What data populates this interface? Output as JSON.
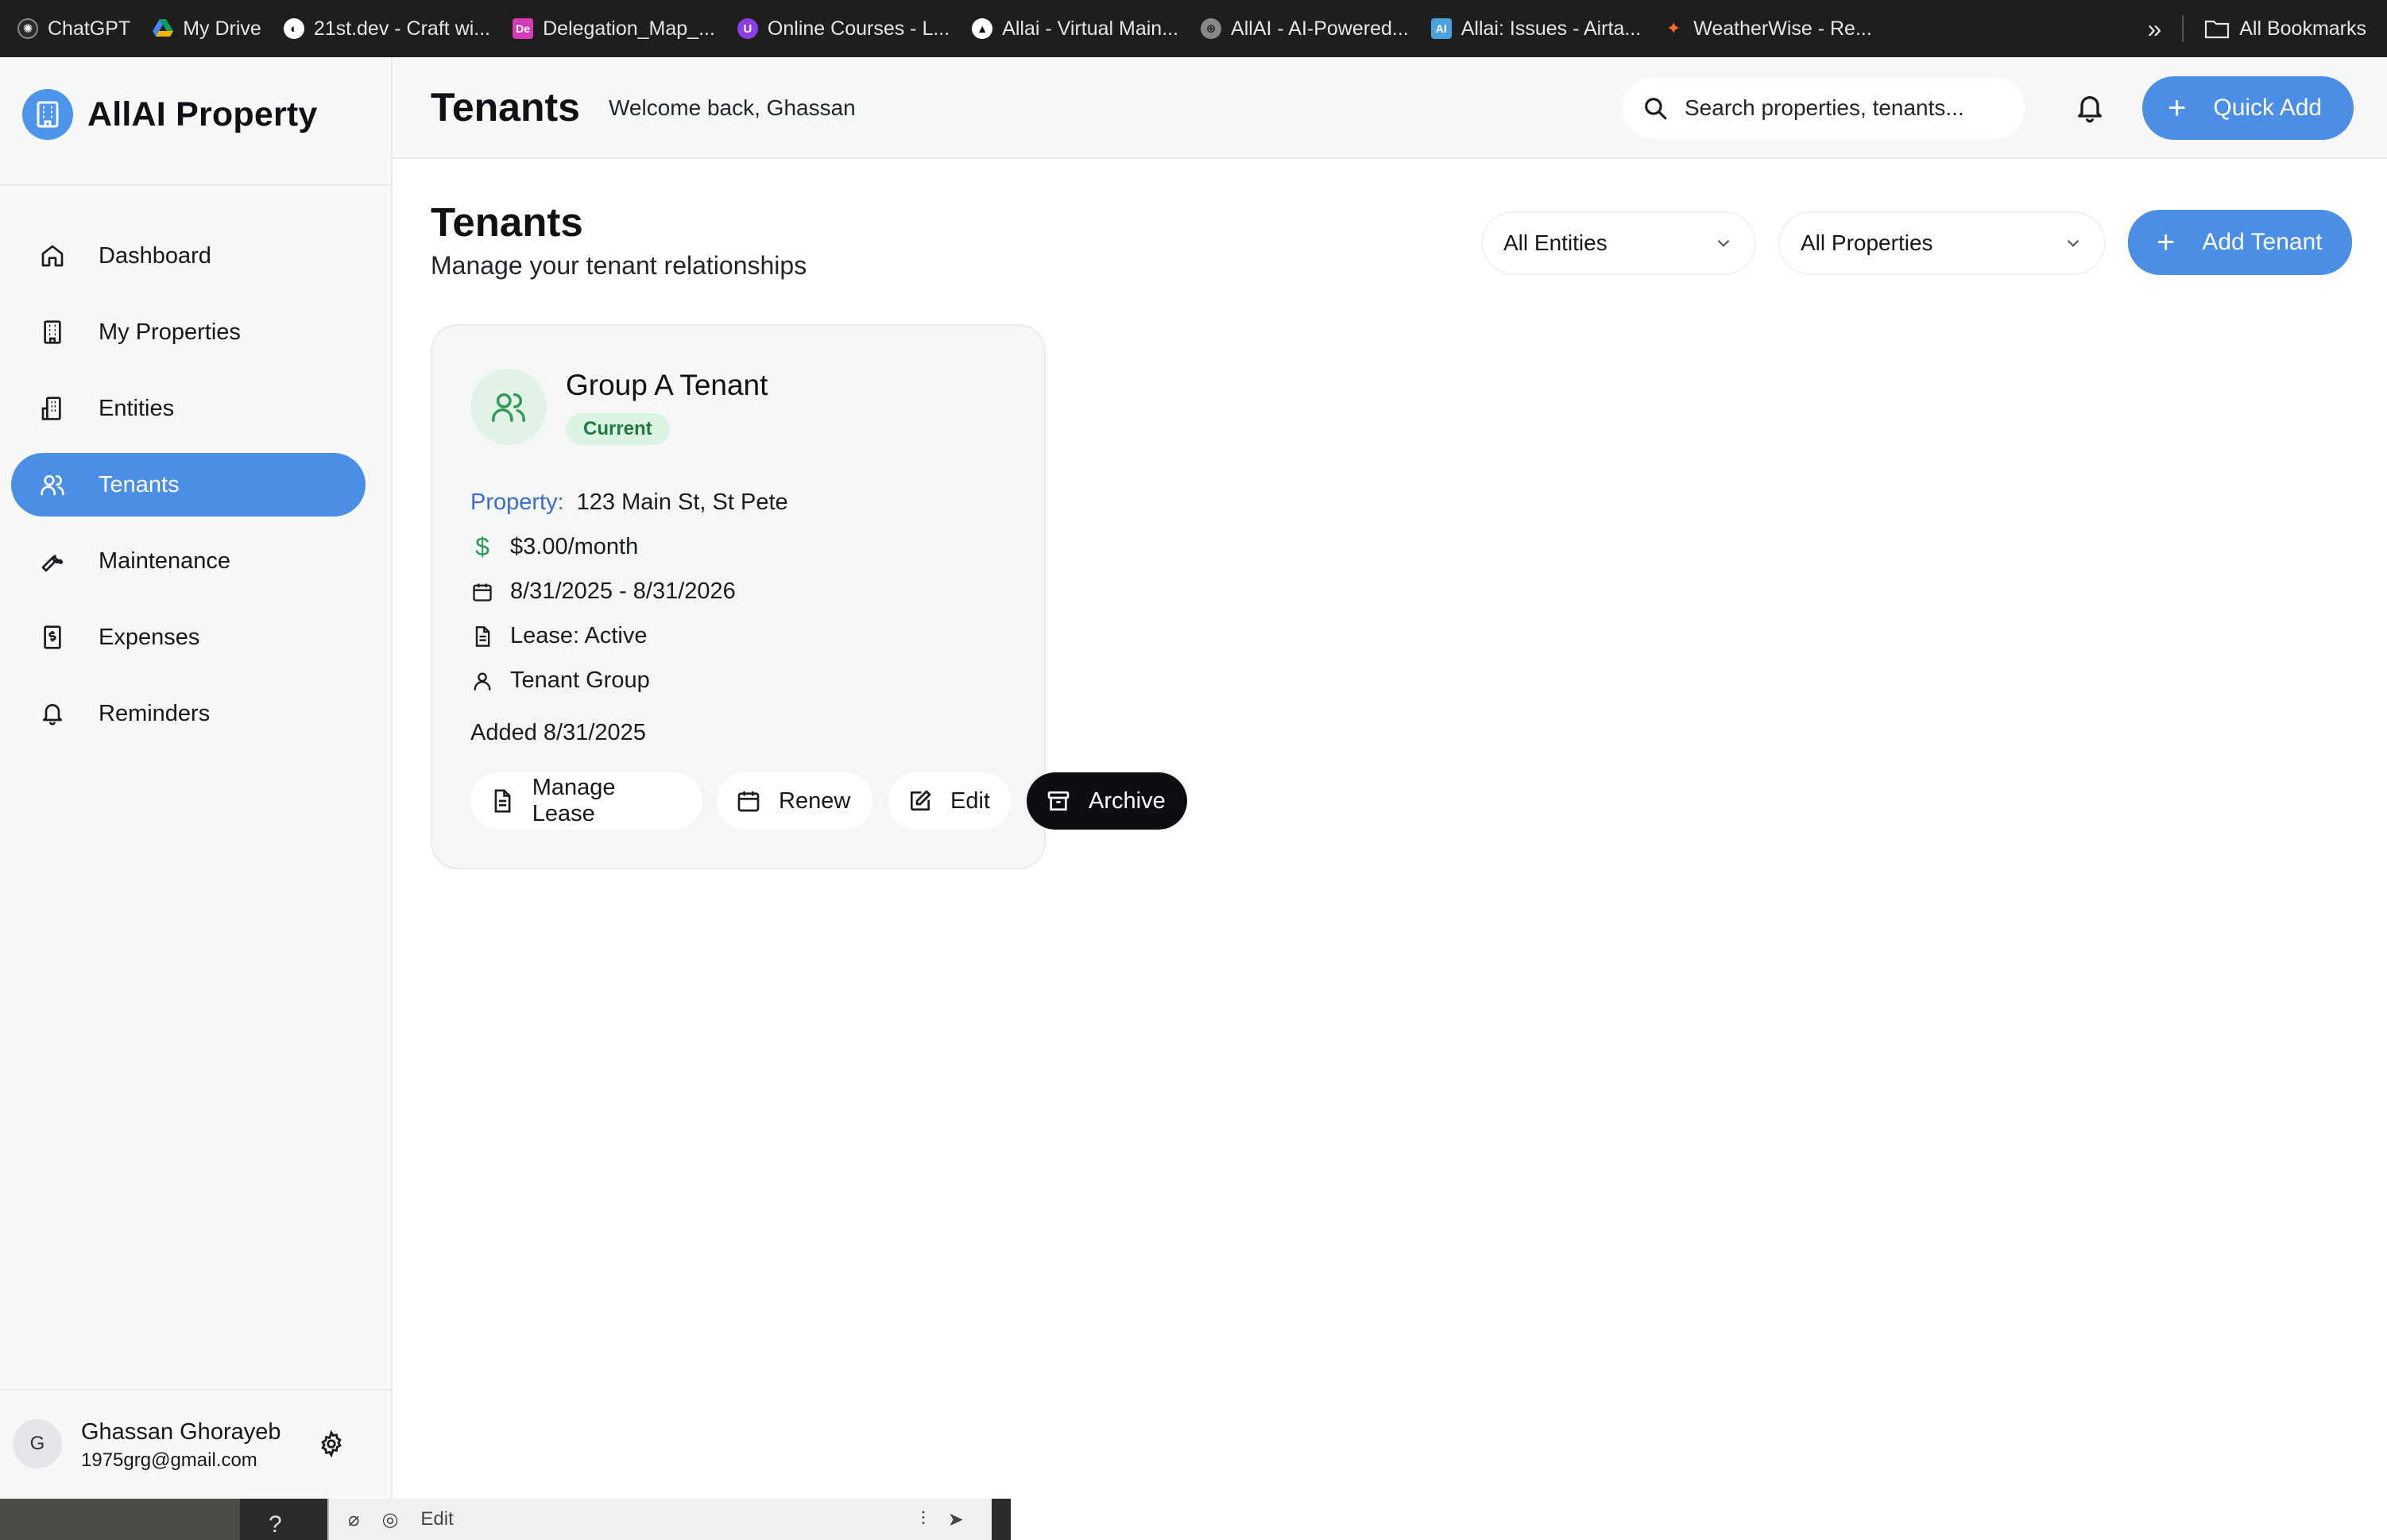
{
  "bookmarks": {
    "items": [
      {
        "label": "ChatGPT",
        "icon": "openai-icon",
        "color": "#2b2b2b"
      },
      {
        "label": "My Drive",
        "icon": "google-drive-icon",
        "color": "#f4b400"
      },
      {
        "label": "21st.dev - Craft wi...",
        "icon": "21st-icon",
        "color": "#ffffff"
      },
      {
        "label": "Delegation_Map_...",
        "icon": "doc-icon",
        "color": "#d63ab8"
      },
      {
        "label": "Online Courses - L...",
        "icon": "udemy-icon",
        "color": "#8f3ee6"
      },
      {
        "label": "Allai - Virtual Main...",
        "icon": "vercel-icon",
        "color": "#ffffff"
      },
      {
        "label": "AllAI - AI-Powered...",
        "icon": "globe-icon",
        "color": "#bbbbbb"
      },
      {
        "label": "Allai: Issues - Airta...",
        "icon": "ai-icon",
        "color": "#4aa3df"
      },
      {
        "label": "WeatherWise - Re...",
        "icon": "figma-icon",
        "color": "#ff6a2b"
      }
    ],
    "overflow": "»",
    "all_bookmarks": "All Bookmarks"
  },
  "brand": {
    "name": "AllAI Property"
  },
  "sidebar": {
    "items": [
      {
        "label": "Dashboard",
        "icon": "home-icon"
      },
      {
        "label": "My Properties",
        "icon": "building-icon"
      },
      {
        "label": "Entities",
        "icon": "entities-icon"
      },
      {
        "label": "Tenants",
        "icon": "users-icon",
        "active": true
      },
      {
        "label": "Maintenance",
        "icon": "wrench-icon"
      },
      {
        "label": "Expenses",
        "icon": "receipt-icon"
      },
      {
        "label": "Reminders",
        "icon": "bell-icon"
      }
    ]
  },
  "user": {
    "initial": "G",
    "name": "Ghassan Ghorayeb",
    "email": "1975grg@gmail.com"
  },
  "topbar": {
    "title": "Tenants",
    "welcome": "Welcome back, Ghassan",
    "search_placeholder": "Search properties, tenants...",
    "quick_add": "Quick Add"
  },
  "page": {
    "title": "Tenants",
    "subtitle": "Manage your tenant relationships",
    "filter_entities": "All Entities",
    "filter_properties": "All Properties",
    "add_tenant": "Add Tenant"
  },
  "tenant_card": {
    "name": "Group A Tenant",
    "status": "Current",
    "property_label": "Property:",
    "property_value": "123 Main St, St Pete",
    "rent": "$3.00/month",
    "lease_dates": "8/31/2025 - 8/31/2026",
    "lease_status": "Lease: Active",
    "tenant_type": "Tenant Group",
    "added": "Added 8/31/2025",
    "actions": {
      "manage_lease": "Manage Lease",
      "renew": "Renew",
      "edit": "Edit",
      "archive": "Archive"
    }
  },
  "bottom_strip": {
    "help": "?",
    "edit": "Edit"
  },
  "colors": {
    "accent": "#4b8ee6",
    "status_green": "#1e7a3d",
    "property_label": "#3b6ccf",
    "archive_bg": "#0c0e12"
  }
}
